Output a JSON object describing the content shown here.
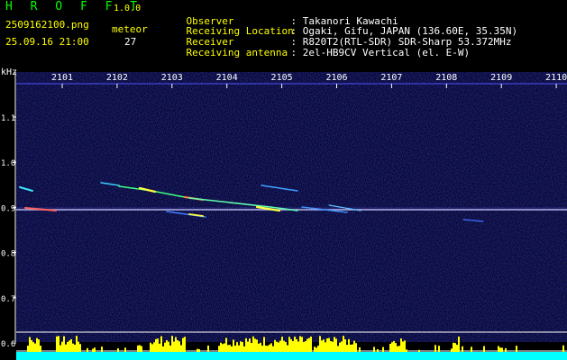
{
  "app": {
    "name": "H R O F F T",
    "version": "1.0.0"
  },
  "file": {
    "name": "2509162100.png",
    "datetime": "25.09.16 21:00"
  },
  "meteor": {
    "label": "meteor",
    "count": "27"
  },
  "info": [
    {
      "label": "Observer",
      "value": ": Takanori Kawachi"
    },
    {
      "label": "Receiving Location",
      "value": ": Ogaki, Gifu, JAPAN (136.60E, 35.35N)"
    },
    {
      "label": "Receiver",
      "value": ": R820T2(RTL-SDR) SDR-Sharp 53.372MHz"
    },
    {
      "label": "Receiving antenna",
      "value": ": 2el-HB9CV Vertical (el. E-W)"
    }
  ],
  "axis": {
    "unit": "kHz",
    "time_ticks": [
      "2101",
      "2102",
      "2103",
      "2104",
      "2105",
      "2106",
      "2107",
      "2108",
      "2109",
      "2110"
    ],
    "freq_ticks": [
      "1.1",
      "1.0",
      "0.9",
      "0.8",
      "0.7",
      "0.6"
    ]
  },
  "colors": {
    "background": "#000000",
    "noise": "#0a0a6e",
    "carrier": "#e0e0ff",
    "meteor_warm": "#ffff40",
    "meteor_hot": "#ff4040",
    "bars": "#ffff00",
    "floor": "#00ffff"
  }
}
